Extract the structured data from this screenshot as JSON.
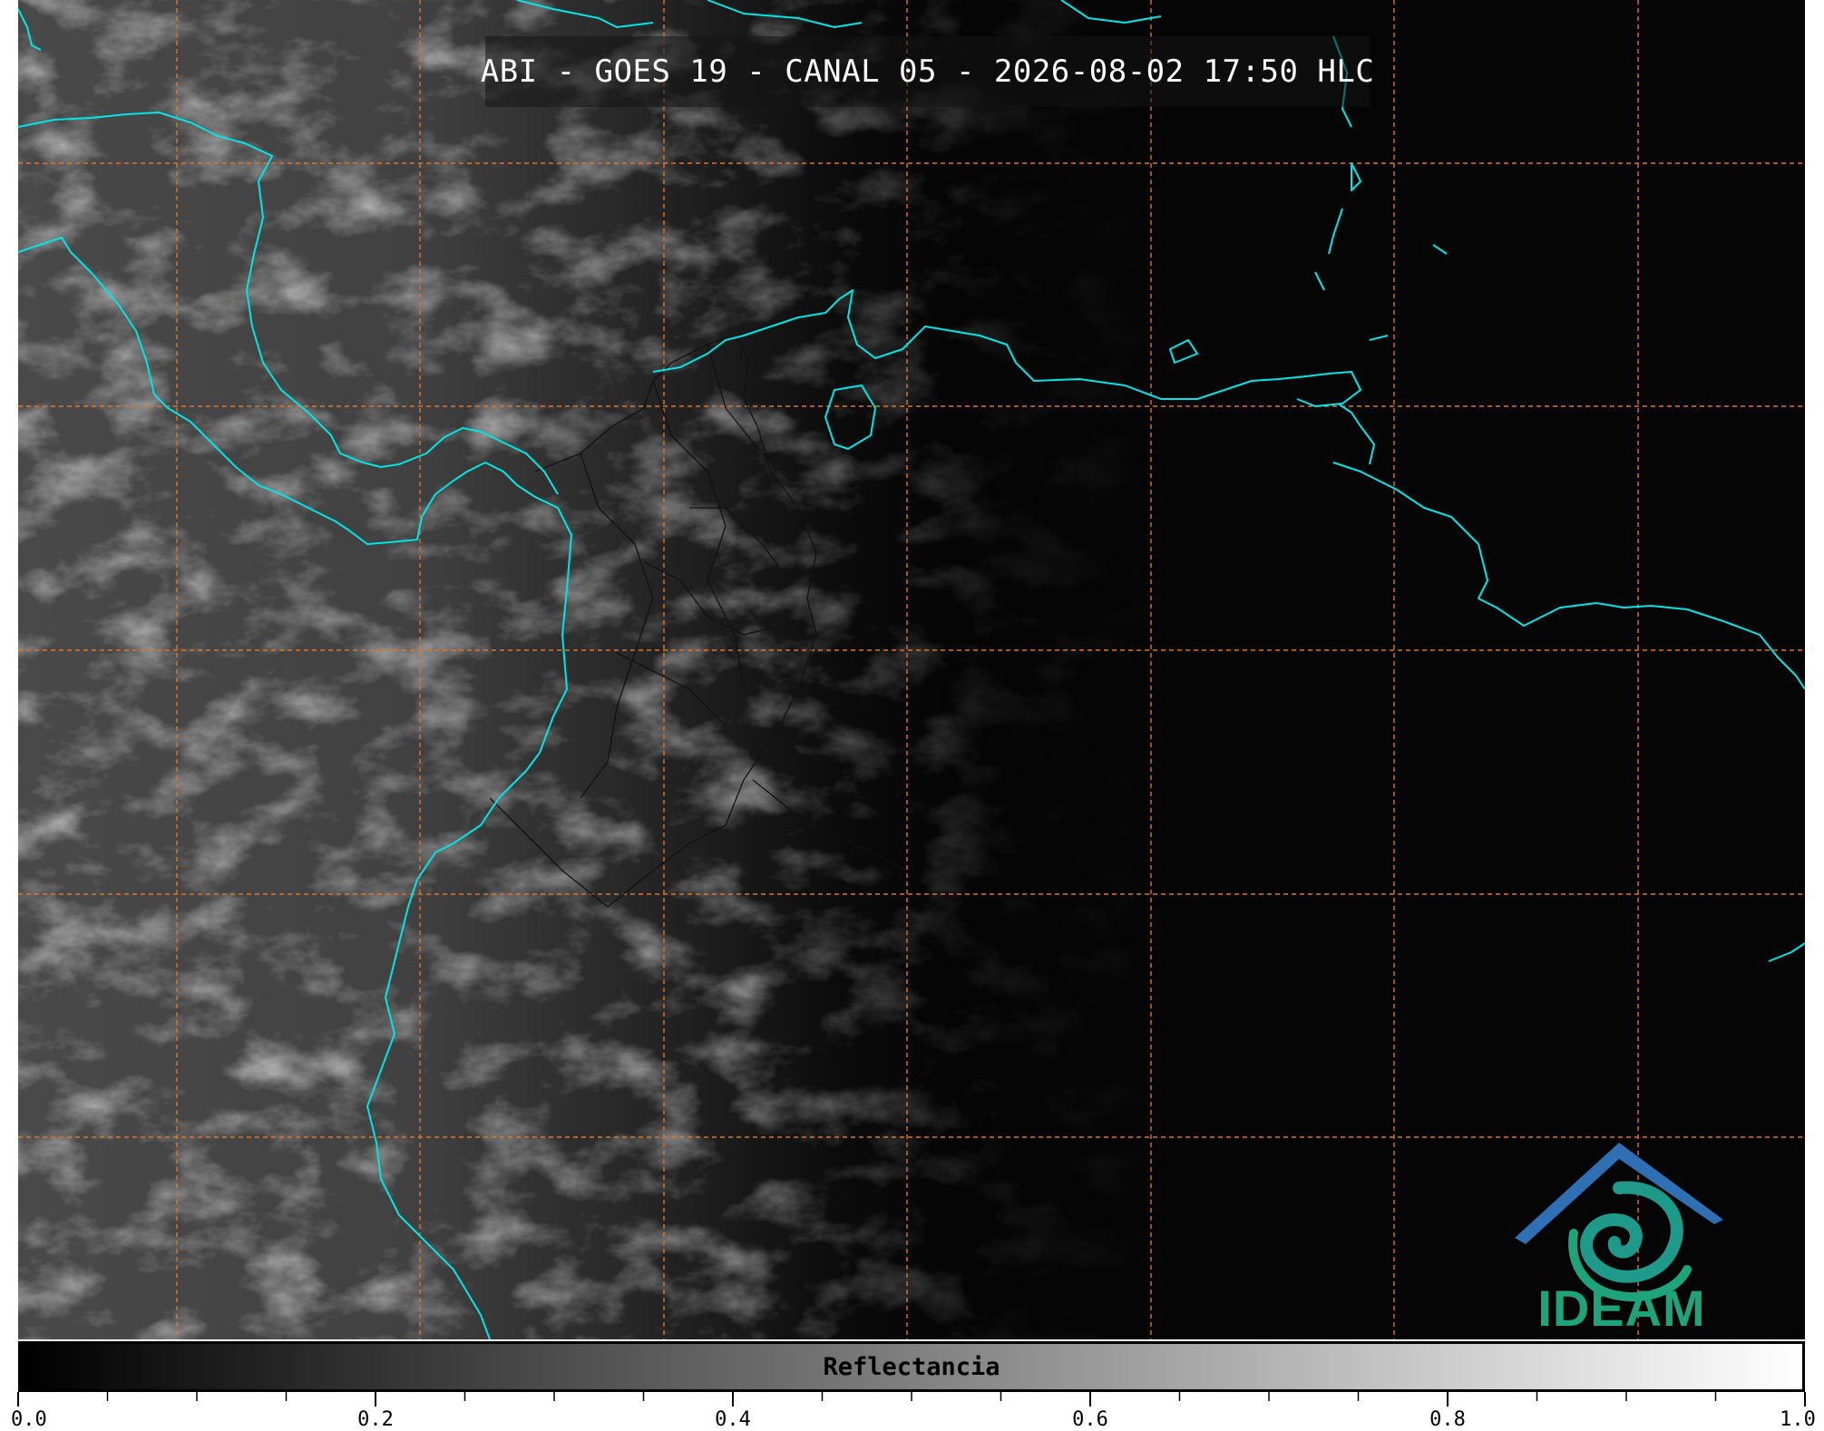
{
  "title": "ABI - GOES 19 - CANAL 05 - 2026-08-02 17:50 HLC",
  "logo": {
    "text": "IDEAM",
    "icon": "ideam-logo-icon",
    "colors": {
      "blue": "#2f6fb3",
      "green": "#1fa37a"
    }
  },
  "colorbar": {
    "label": "Reflectancia",
    "min": 0.0,
    "max": 1.0,
    "tick_labels": [
      "0.0",
      "0.2",
      "0.4",
      "0.6",
      "0.8",
      "1.0"
    ],
    "tick_values": [
      0.0,
      0.2,
      0.4,
      0.6,
      0.8,
      1.0
    ],
    "minor_step": 0.05
  },
  "colors": {
    "coastline": "#00e5e5",
    "graticule": "#d9772b",
    "borders": "#111111"
  }
}
